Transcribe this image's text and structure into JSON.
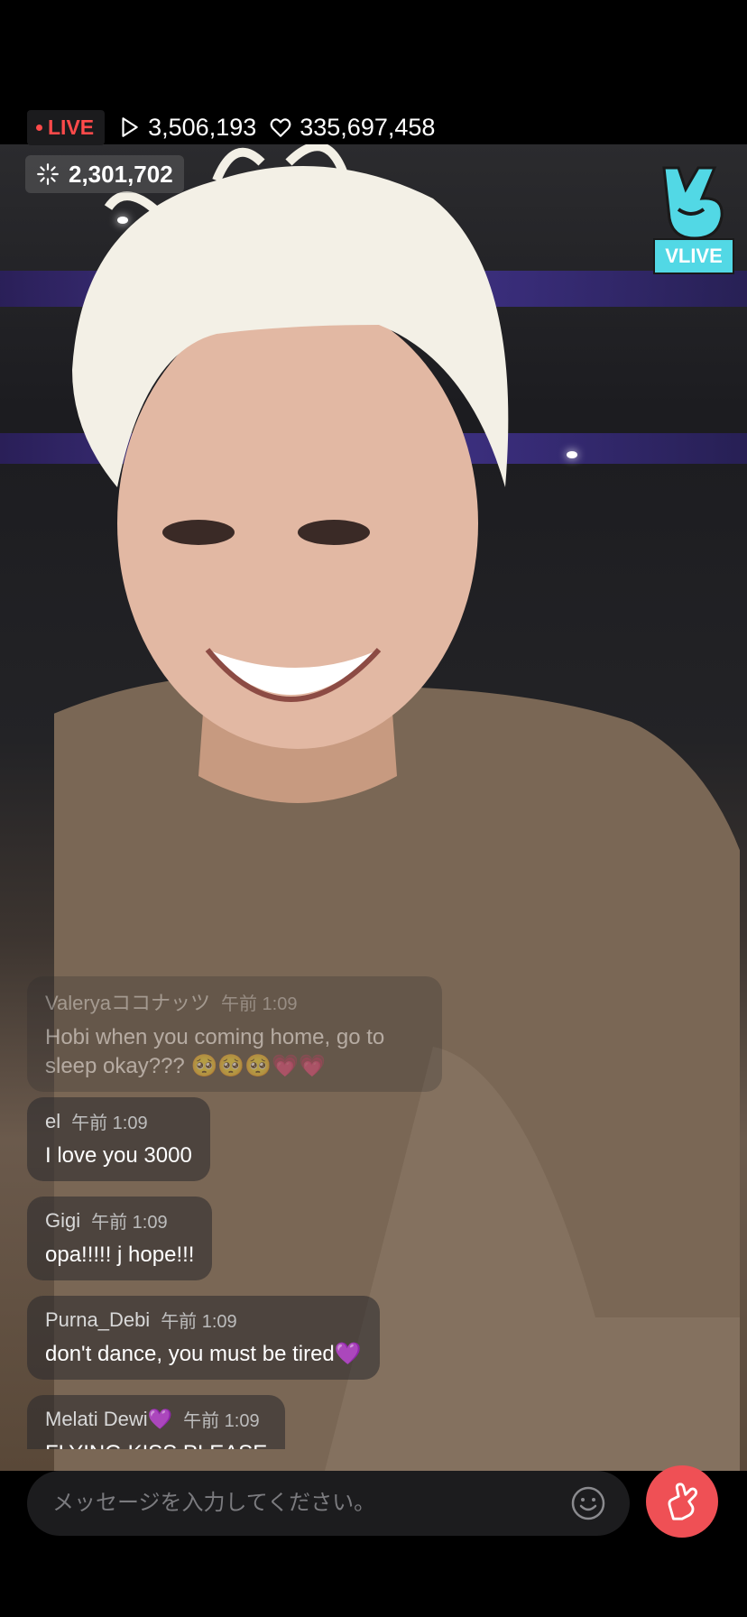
{
  "status": {
    "live_label": "LIVE",
    "play_count": "3,506,193",
    "like_count": "335,697,458",
    "viewer_count": "2,301,702"
  },
  "brand": {
    "logo_text": "VLIVE",
    "accent": "#52d8e5"
  },
  "chat": [
    {
      "user": "Valeryaココナッツ",
      "time": "午前 1:09",
      "message": "Hobi when you coming home, go to sleep okay??? 🥺🥺🥺💗💗",
      "faded": true
    },
    {
      "user": "el",
      "time": "午前 1:09",
      "message": "I love you 3000"
    },
    {
      "user": "Gigi",
      "time": "午前 1:09",
      "message": "opa!!!!! j hope!!!"
    },
    {
      "user": "Purna_Debi",
      "time": "午前 1:09",
      "message": "don't dance, you must be tired💜"
    },
    {
      "user": "Melati Dewi💜",
      "time": "午前 1:09",
      "message": "FLYING KISS PLEASE"
    }
  ],
  "composer": {
    "placeholder": "メッセージを入力してください。",
    "emoji_icon": "smiley-icon",
    "send_heart_icon": "finger-heart-icon",
    "send_color": "#ef5055"
  }
}
